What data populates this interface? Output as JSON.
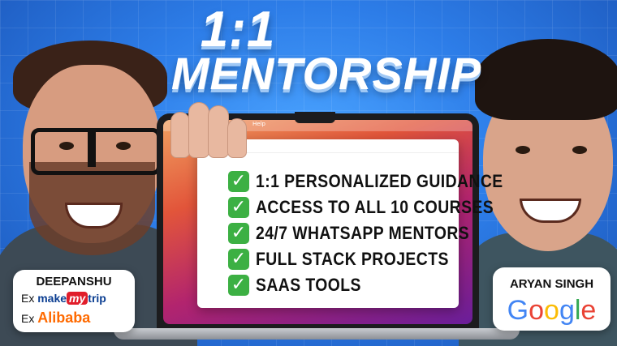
{
  "title": {
    "line1": "1:1",
    "line2": "MENTORSHIP"
  },
  "laptop": {
    "menu_label": "Help"
  },
  "features": [
    "1:1 PERSONALIZED GUIDANCE",
    "ACCESS TO ALL 10 COURSES",
    "24/7 WHATSAPP MENTORS",
    "FULL STACK PROJECTS",
    "SAAS TOOLS"
  ],
  "check_icon": "✓",
  "mentor_left": {
    "name": "DEEPANSHU",
    "prefix1": "Ex",
    "company1_part1": "make",
    "company1_part2": "my",
    "company1_part3": "trip",
    "prefix2": "Ex",
    "company2": "Alibaba"
  },
  "mentor_right": {
    "name": "ARYAN SINGH",
    "company": [
      "G",
      "o",
      "o",
      "g",
      "l",
      "e"
    ]
  },
  "colors": {
    "background": "#2d7de8",
    "check": "#3cb043",
    "alibaba": "#ff6a00"
  }
}
